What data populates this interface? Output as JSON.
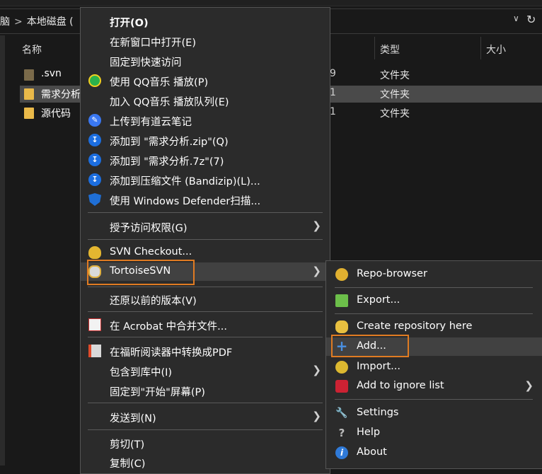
{
  "explorer": {
    "breadcrumb": [
      "脑",
      "本地磁盘 ("
    ],
    "columns": {
      "name": "名称",
      "type": "类型",
      "size": "大小"
    },
    "files": [
      {
        "name": ".svn",
        "date": "9",
        "type": "文件夹"
      },
      {
        "name": "需求分析",
        "date": "1",
        "type": "文件夹"
      },
      {
        "name": "源代码",
        "date": "1",
        "type": "文件夹"
      }
    ]
  },
  "context_menu": {
    "items": [
      {
        "label": "打开(O)"
      },
      {
        "label": "在新窗口中打开(E)"
      },
      {
        "label": "固定到快速访问"
      },
      {
        "label": "使用 QQ音乐 播放(P)"
      },
      {
        "label": "加入 QQ音乐 播放队列(E)"
      },
      {
        "label": "上传到有道云笔记"
      },
      {
        "label": "添加到 \"需求分析.zip\"(Q)"
      },
      {
        "label": "添加到 \"需求分析.7z\"(7)"
      },
      {
        "label": "添加到压缩文件 (Bandizip)(L)..."
      },
      {
        "label": "使用 Windows Defender扫描..."
      },
      {
        "label": "授予访问权限(G)"
      },
      {
        "label": "SVN Checkout..."
      },
      {
        "label": "TortoiseSVN"
      },
      {
        "label": "还原以前的版本(V)"
      },
      {
        "label": "在 Acrobat 中合并文件..."
      },
      {
        "label": "在福昕阅读器中转换成PDF"
      },
      {
        "label": "包含到库中(I)"
      },
      {
        "label": "固定到\"开始\"屏幕(P)"
      },
      {
        "label": "发送到(N)"
      },
      {
        "label": "剪切(T)"
      },
      {
        "label": "复制(C)"
      }
    ]
  },
  "tortoise_submenu": {
    "items": [
      {
        "label": "Repo-browser"
      },
      {
        "label": "Export..."
      },
      {
        "label": "Create repository here"
      },
      {
        "label": "Add..."
      },
      {
        "label": "Import..."
      },
      {
        "label": "Add to ignore list"
      },
      {
        "label": "Settings"
      },
      {
        "label": "Help"
      },
      {
        "label": "About"
      }
    ]
  },
  "colors": {
    "highlight_outline": "#e07b22",
    "menu_bg": "#2b2b2b"
  }
}
